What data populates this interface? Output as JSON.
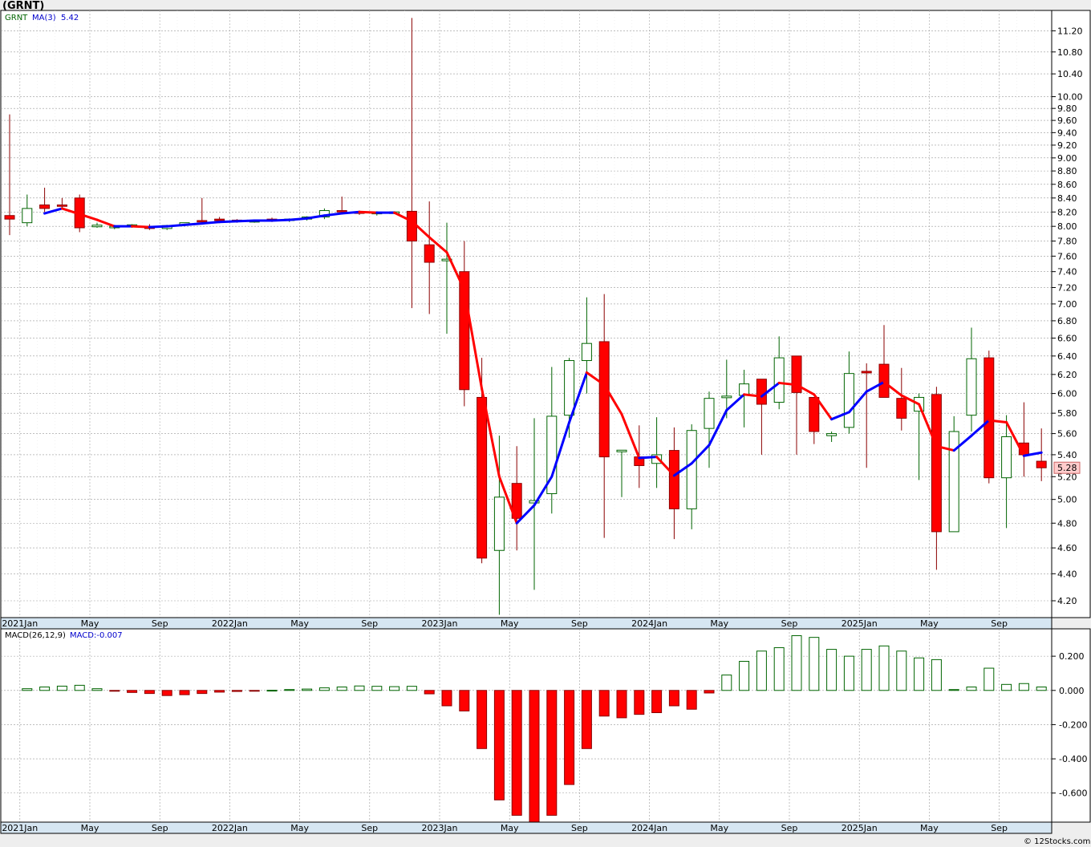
{
  "title": "(GRNT)",
  "credit": "© 12Stocks.com",
  "colors": {
    "up_fill": "#ffffff",
    "up_stroke": "#006400",
    "down_fill": "#ff0000",
    "down_stroke": "#8b0000",
    "ma_up": "#0000ff",
    "ma_down": "#ff0000",
    "axis_bar": "#d6e6f2",
    "grid": "#999999"
  },
  "price_panel": {
    "ticker": "GRNT",
    "ma_label": "MA(3)",
    "ma_value": "5.42",
    "ticker_color": "#006400",
    "ma_color": "#0000cc",
    "last_price": "5.28",
    "yticks": [
      "4.20",
      "4.40",
      "4.60",
      "4.80",
      "5.00",
      "5.20",
      "5.40",
      "5.60",
      "5.80",
      "6.00",
      "6.20",
      "6.40",
      "6.60",
      "6.80",
      "7.00",
      "7.20",
      "7.40",
      "7.60",
      "7.80",
      "8.00",
      "8.20",
      "8.40",
      "8.60",
      "8.80",
      "9.00",
      "9.20",
      "9.40",
      "9.60",
      "9.80",
      "10.00",
      "10.40",
      "10.80",
      "11.20"
    ],
    "scale": "log",
    "ylim": [
      4.08,
      11.6
    ]
  },
  "macd_panel": {
    "label": "MACD(26,12,9)",
    "value_label": "MACD:-0.007",
    "label_color": "#000000",
    "value_color": "#0000cc",
    "yticks": [
      "-0.600",
      "-0.400",
      "-0.200",
      "0.000",
      "0.200"
    ],
    "ylim": [
      -0.77,
      0.36
    ]
  },
  "x_axis": {
    "ticks": [
      "2021Jan",
      "May",
      "Sep",
      "2022Jan",
      "May",
      "Sep",
      "2023Jan",
      "May",
      "Sep",
      "2024Jan",
      "May",
      "Sep",
      "2025Jan",
      "May",
      "Sep"
    ]
  },
  "chart_data": {
    "type": "candlestick",
    "interval": "monthly",
    "start": "2020-12",
    "end": "2025-10",
    "candles": [
      {
        "o": 8.15,
        "h": 9.7,
        "l": 7.88,
        "c": 8.1
      },
      {
        "o": 8.05,
        "h": 8.45,
        "l": 8.0,
        "c": 8.25
      },
      {
        "o": 8.3,
        "h": 8.55,
        "l": 8.2,
        "c": 8.25
      },
      {
        "o": 8.3,
        "h": 8.4,
        "l": 8.25,
        "c": 8.28
      },
      {
        "o": 8.4,
        "h": 8.45,
        "l": 7.92,
        "c": 7.98
      },
      {
        "o": 8.0,
        "h": 8.05,
        "l": 7.98,
        "c": 8.01
      },
      {
        "o": 7.98,
        "h": 8.02,
        "l": 7.96,
        "c": 8.0
      },
      {
        "o": 8.01,
        "h": 8.03,
        "l": 7.98,
        "c": 8.01
      },
      {
        "o": 8.0,
        "h": 8.03,
        "l": 7.95,
        "c": 7.97
      },
      {
        "o": 7.97,
        "h": 8.02,
        "l": 7.95,
        "c": 8.01
      },
      {
        "o": 8.02,
        "h": 8.05,
        "l": 8.0,
        "c": 8.05
      },
      {
        "o": 8.08,
        "h": 8.4,
        "l": 8.05,
        "c": 8.06
      },
      {
        "o": 8.1,
        "h": 8.13,
        "l": 8.07,
        "c": 8.08
      },
      {
        "o": 8.08,
        "h": 8.1,
        "l": 8.05,
        "c": 8.07
      },
      {
        "o": 8.07,
        "h": 8.09,
        "l": 8.05,
        "c": 8.07
      },
      {
        "o": 8.1,
        "h": 8.12,
        "l": 8.06,
        "c": 8.08
      },
      {
        "o": 8.08,
        "h": 8.11,
        "l": 8.06,
        "c": 8.1
      },
      {
        "o": 8.1,
        "h": 8.14,
        "l": 8.08,
        "c": 8.13
      },
      {
        "o": 8.13,
        "h": 8.25,
        "l": 8.1,
        "c": 8.22
      },
      {
        "o": 8.22,
        "h": 8.42,
        "l": 8.18,
        "c": 8.2
      },
      {
        "o": 8.2,
        "h": 8.22,
        "l": 8.16,
        "c": 8.18
      },
      {
        "o": 8.18,
        "h": 8.21,
        "l": 8.15,
        "c": 8.19
      },
      {
        "o": 8.19,
        "h": 8.21,
        "l": 8.17,
        "c": 8.19
      },
      {
        "o": 8.21,
        "h": 11.45,
        "l": 6.95,
        "c": 7.8
      },
      {
        "o": 7.75,
        "h": 8.35,
        "l": 6.88,
        "c": 7.52
      },
      {
        "o": 7.55,
        "h": 8.05,
        "l": 6.65,
        "c": 7.55
      },
      {
        "o": 7.4,
        "h": 7.8,
        "l": 5.87,
        "c": 6.04
      },
      {
        "o": 5.96,
        "h": 6.38,
        "l": 4.48,
        "c": 4.52
      },
      {
        "o": 4.58,
        "h": 5.58,
        "l": 4.1,
        "c": 5.02
      },
      {
        "o": 5.14,
        "h": 5.48,
        "l": 4.58,
        "c": 4.84
      },
      {
        "o": 4.97,
        "h": 5.75,
        "l": 4.28,
        "c": 4.99
      },
      {
        "o": 5.05,
        "h": 6.28,
        "l": 4.88,
        "c": 5.77
      },
      {
        "o": 5.78,
        "h": 6.38,
        "l": 5.56,
        "c": 6.35
      },
      {
        "o": 6.35,
        "h": 7.08,
        "l": 6.0,
        "c": 6.54
      },
      {
        "o": 6.56,
        "h": 7.12,
        "l": 4.68,
        "c": 5.38
      },
      {
        "o": 5.43,
        "h": 5.44,
        "l": 5.02,
        "c": 5.44
      },
      {
        "o": 5.38,
        "h": 5.68,
        "l": 5.1,
        "c": 5.3
      },
      {
        "o": 5.32,
        "h": 5.76,
        "l": 5.1,
        "c": 5.4
      },
      {
        "o": 5.44,
        "h": 5.66,
        "l": 4.67,
        "c": 4.92
      },
      {
        "o": 4.92,
        "h": 5.69,
        "l": 4.75,
        "c": 5.63
      },
      {
        "o": 5.65,
        "h": 6.02,
        "l": 5.28,
        "c": 5.95
      },
      {
        "o": 5.96,
        "h": 6.36,
        "l": 5.75,
        "c": 5.97
      },
      {
        "o": 5.98,
        "h": 6.25,
        "l": 5.66,
        "c": 6.1
      },
      {
        "o": 6.15,
        "h": 6.1,
        "l": 5.4,
        "c": 5.89
      },
      {
        "o": 5.91,
        "h": 6.62,
        "l": 5.84,
        "c": 6.38
      },
      {
        "o": 6.4,
        "h": 6.4,
        "l": 5.4,
        "c": 6.01
      },
      {
        "o": 5.96,
        "h": 5.96,
        "l": 5.5,
        "c": 5.62
      },
      {
        "o": 5.58,
        "h": 5.62,
        "l": 5.52,
        "c": 5.6
      },
      {
        "o": 5.66,
        "h": 6.45,
        "l": 5.6,
        "c": 6.21
      },
      {
        "o": 6.23,
        "h": 6.32,
        "l": 5.28,
        "c": 6.22
      },
      {
        "o": 6.31,
        "h": 6.75,
        "l": 5.98,
        "c": 5.96
      },
      {
        "o": 5.95,
        "h": 6.27,
        "l": 5.63,
        "c": 5.75
      },
      {
        "o": 5.82,
        "h": 6.0,
        "l": 5.17,
        "c": 5.96
      },
      {
        "o": 5.99,
        "h": 6.07,
        "l": 4.43,
        "c": 4.73
      },
      {
        "o": 4.73,
        "h": 5.77,
        "l": 4.73,
        "c": 5.62
      },
      {
        "o": 5.78,
        "h": 6.72,
        "l": 5.62,
        "c": 6.37
      },
      {
        "o": 6.38,
        "h": 6.46,
        "l": 5.14,
        "c": 5.19
      },
      {
        "o": 5.19,
        "h": 5.78,
        "l": 4.76,
        "c": 5.57
      },
      {
        "o": 5.51,
        "h": 5.91,
        "l": 5.2,
        "c": 5.4
      },
      {
        "o": 5.34,
        "h": 5.65,
        "l": 5.16,
        "c": 5.28
      }
    ],
    "ma3": [
      null,
      null,
      8.18,
      8.25,
      8.17,
      8.09,
      8.0,
      8.0,
      7.99,
      8.0,
      8.02,
      8.04,
      8.06,
      8.07,
      8.08,
      8.08,
      8.09,
      8.11,
      8.15,
      8.18,
      8.2,
      8.19,
      8.19,
      8.07,
      7.85,
      7.65,
      7.17,
      6.05,
      5.2,
      4.8,
      4.95,
      5.2,
      5.71,
      6.22,
      6.09,
      5.79,
      5.37,
      5.38,
      5.21,
      5.32,
      5.49,
      5.83,
      5.99,
      5.97,
      6.11,
      6.09,
      5.99,
      5.74,
      5.81,
      6.02,
      6.12,
      5.98,
      5.89,
      5.48,
      5.44,
      5.58,
      5.73,
      5.71,
      5.39,
      5.42
    ],
    "macd": [
      0.01,
      0.02,
      0.025,
      0.03,
      0.01,
      -0.003,
      -0.012,
      -0.018,
      -0.03,
      -0.025,
      -0.018,
      -0.01,
      -0.006,
      -0.002,
      0.001,
      0.005,
      0.008,
      0.015,
      0.02,
      0.026,
      0.024,
      0.022,
      0.024,
      -0.02,
      -0.09,
      -0.12,
      -0.34,
      -0.64,
      -0.73,
      -0.77,
      -0.73,
      -0.55,
      -0.34,
      -0.15,
      -0.16,
      -0.14,
      -0.13,
      -0.09,
      -0.11,
      -0.015,
      0.09,
      0.17,
      0.23,
      0.25,
      0.32,
      0.31,
      0.24,
      0.2,
      0.24,
      0.26,
      0.23,
      0.19,
      0.18,
      0.005,
      0.02,
      0.13,
      0.035,
      0.04,
      0.02,
      -0.007
    ]
  }
}
